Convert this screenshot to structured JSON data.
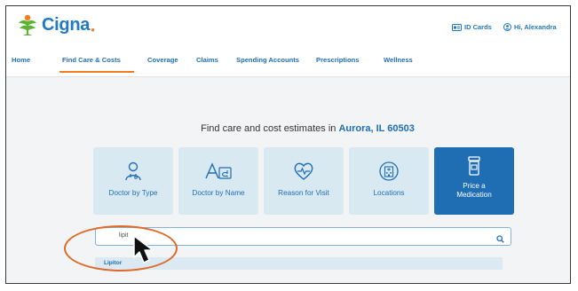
{
  "brand": {
    "name": "Cigna"
  },
  "header": {
    "id_cards_label": "ID Cards",
    "greeting": "Hi, Alexandra"
  },
  "nav": {
    "items": [
      {
        "label": "Home",
        "active": false
      },
      {
        "label": "Find Care & Costs",
        "active": true
      },
      {
        "label": "Coverage",
        "active": false
      },
      {
        "label": "Claims",
        "active": false
      },
      {
        "label": "Spending Accounts",
        "active": false
      },
      {
        "label": "Prescriptions",
        "active": false
      },
      {
        "label": "Wellness",
        "active": false
      }
    ]
  },
  "main": {
    "headline_prefix": "Find care and cost estimates in",
    "headline_location": "Aurora, IL 60503",
    "tiles": [
      {
        "label": "Doctor by Type",
        "icon": "doctor-icon",
        "active": false
      },
      {
        "label": "Doctor by Name",
        "icon": "text-aa-icon",
        "active": false
      },
      {
        "label": "Reason for Visit",
        "icon": "heart-pulse-icon",
        "active": false
      },
      {
        "label": "Locations",
        "icon": "hospital-building-icon",
        "active": false
      },
      {
        "label_line1": "Price a",
        "label_line2": "Medication",
        "icon": "pill-bottle-icon",
        "active": true
      }
    ],
    "search": {
      "value": "lipit",
      "icon": "search-icon"
    },
    "suggestion": "Lipitor"
  },
  "colors": {
    "brand_blue": "#1f6db3",
    "accent_orange": "#f47b20",
    "tile_bg": "#d8e9f1",
    "annotation_orange": "#e06a2a"
  }
}
